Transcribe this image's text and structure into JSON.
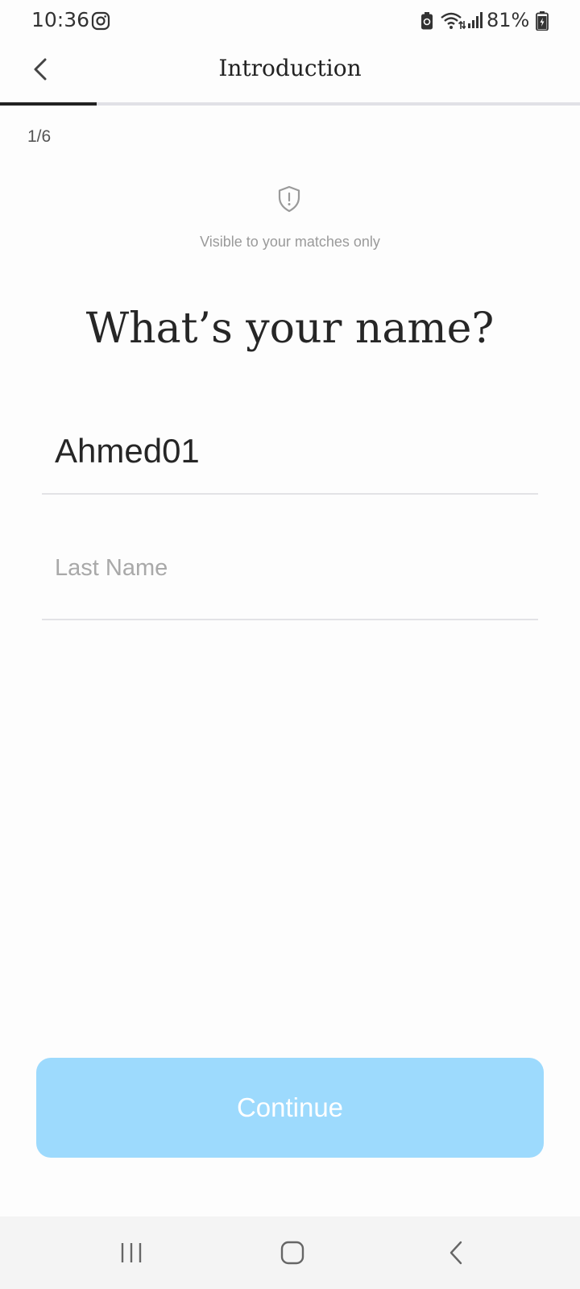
{
  "status_bar": {
    "time": "10:36",
    "battery_percent": "81%",
    "icons": [
      "instagram-icon",
      "battery-saver-icon",
      "wifi-icon",
      "signal-icon",
      "battery-icon"
    ]
  },
  "header": {
    "title": "Introduction",
    "back_icon": "chevron-left-icon",
    "progress": 0.1667
  },
  "step_counter": "1/6",
  "privacy": {
    "icon": "shield-alert-icon",
    "note": "Visible to your matches only"
  },
  "question": "What’s your name?",
  "form": {
    "first_name_value": "Ahmed01",
    "last_name_placeholder": "Last Name",
    "last_name_value": ""
  },
  "continue_button": {
    "label": "Continue",
    "color": "#9ddafd"
  },
  "nav_bar": {
    "icons": [
      "recent-apps-icon",
      "home-icon",
      "back-icon"
    ]
  },
  "colors": {
    "background": "#fdfdfd",
    "progress_fill": "#222222",
    "progress_track": "#e1e1e6",
    "button_disabled": "#9ddafd"
  }
}
